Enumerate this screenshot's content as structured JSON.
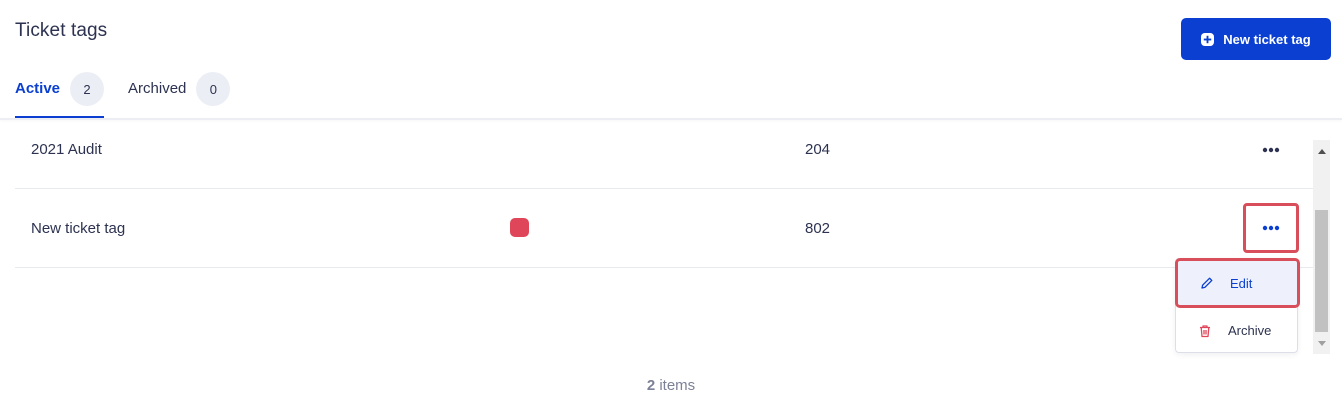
{
  "header": {
    "title": "Ticket tags",
    "new_button_label": "New ticket tag"
  },
  "tabs": [
    {
      "label": "Active",
      "count": "2",
      "active": true
    },
    {
      "label": "Archived",
      "count": "0",
      "active": false
    }
  ],
  "rows": [
    {
      "name": "2021 Audit",
      "color": null,
      "count": "204"
    },
    {
      "name": "New ticket tag",
      "color": "#e0465a",
      "count": "802"
    }
  ],
  "menu": {
    "items": [
      {
        "label": "Edit",
        "icon": "pencil-icon"
      },
      {
        "label": "Archive",
        "icon": "trash-icon"
      }
    ]
  },
  "footer": {
    "count": "2",
    "suffix": "items"
  },
  "colors": {
    "accent": "#0a3fd1",
    "highlight": "#d84e5a",
    "trash": "#e0465a"
  }
}
